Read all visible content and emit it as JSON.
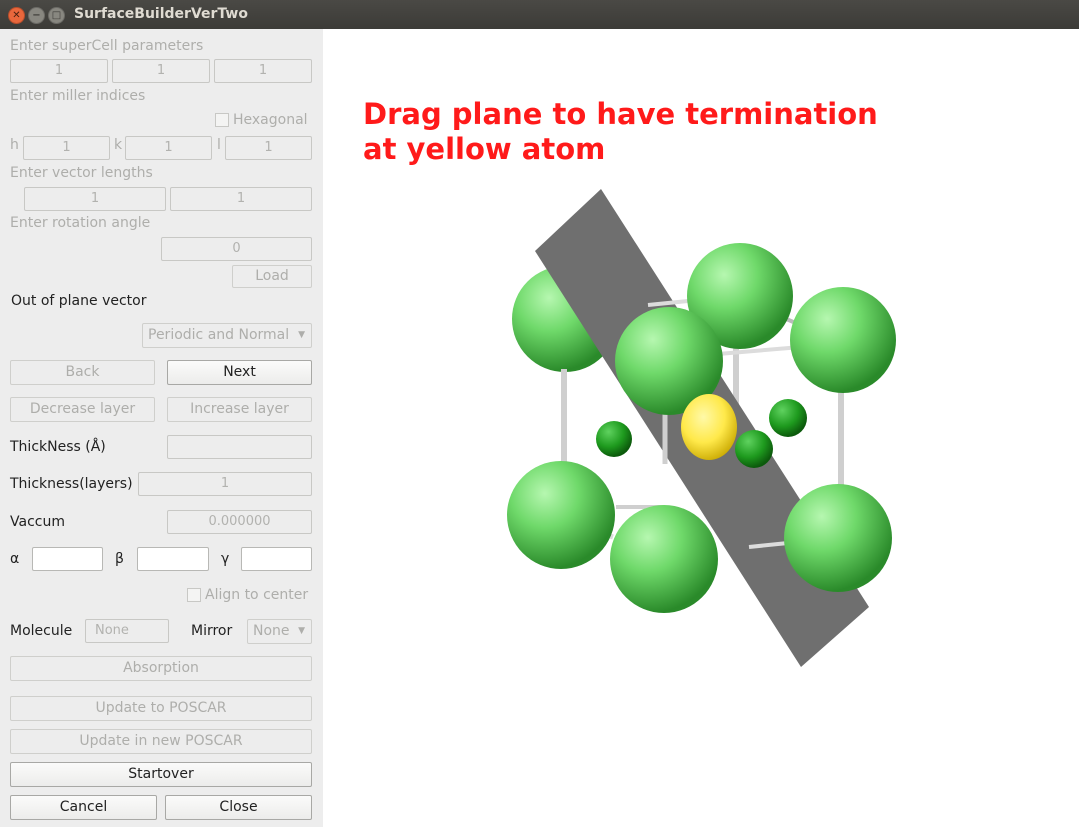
{
  "window": {
    "title": "SurfaceBuilderVerTwo"
  },
  "panel": {
    "supercell": {
      "label": "Enter superCell parameters",
      "values": [
        "1",
        "1",
        "1"
      ]
    },
    "miller": {
      "label": "Enter miller indices",
      "hexagonal_label": "Hexagonal",
      "h_label": "h",
      "h_value": "1",
      "k_label": "k",
      "k_value": "1",
      "l_label": "l",
      "l_value": "1"
    },
    "vector_lengths": {
      "label": "Enter vector lengths",
      "values": [
        "1",
        "1"
      ]
    },
    "rotation": {
      "label": "Enter rotation angle",
      "value": "0"
    },
    "load_label": "Load",
    "out_of_plane": {
      "label": "Out of plane vector",
      "selected": "Periodic and Normal"
    },
    "back_label": "Back",
    "next_label": "Next",
    "decrease_layer_label": "Decrease layer",
    "increase_layer_label": "Increase layer",
    "thickness_a": {
      "label": "ThickNess (Å)",
      "value": ""
    },
    "thickness_layers": {
      "label": "Thickness(layers)",
      "value": "1"
    },
    "vaccum": {
      "label": "Vaccum",
      "value": "0.000000"
    },
    "angles": {
      "alpha_label": "α",
      "beta_label": "β",
      "gamma_label": "γ",
      "alpha": "",
      "beta": "",
      "gamma": ""
    },
    "align_center_label": "Align to center",
    "molecule": {
      "label": "Molecule",
      "value": "None"
    },
    "mirror": {
      "label": "Mirror",
      "selected": "None"
    },
    "absorption_label": "Absorption",
    "update_poscar_label": "Update to POSCAR",
    "update_new_poscar_label": "Update in new POSCAR",
    "startover_label": "Startover",
    "cancel_label": "Cancel",
    "close_label": "Close"
  },
  "viewer": {
    "instruction": "Drag plane to have termination\nat yellow atom",
    "colors": {
      "instruction": "#ff1a1a",
      "large_atom": "#7ee07e",
      "small_atom": "#1fa51f",
      "yellow_atom": "#ffe94a",
      "plane": "#6e6e6e",
      "bond": "#d5d5d5"
    }
  }
}
